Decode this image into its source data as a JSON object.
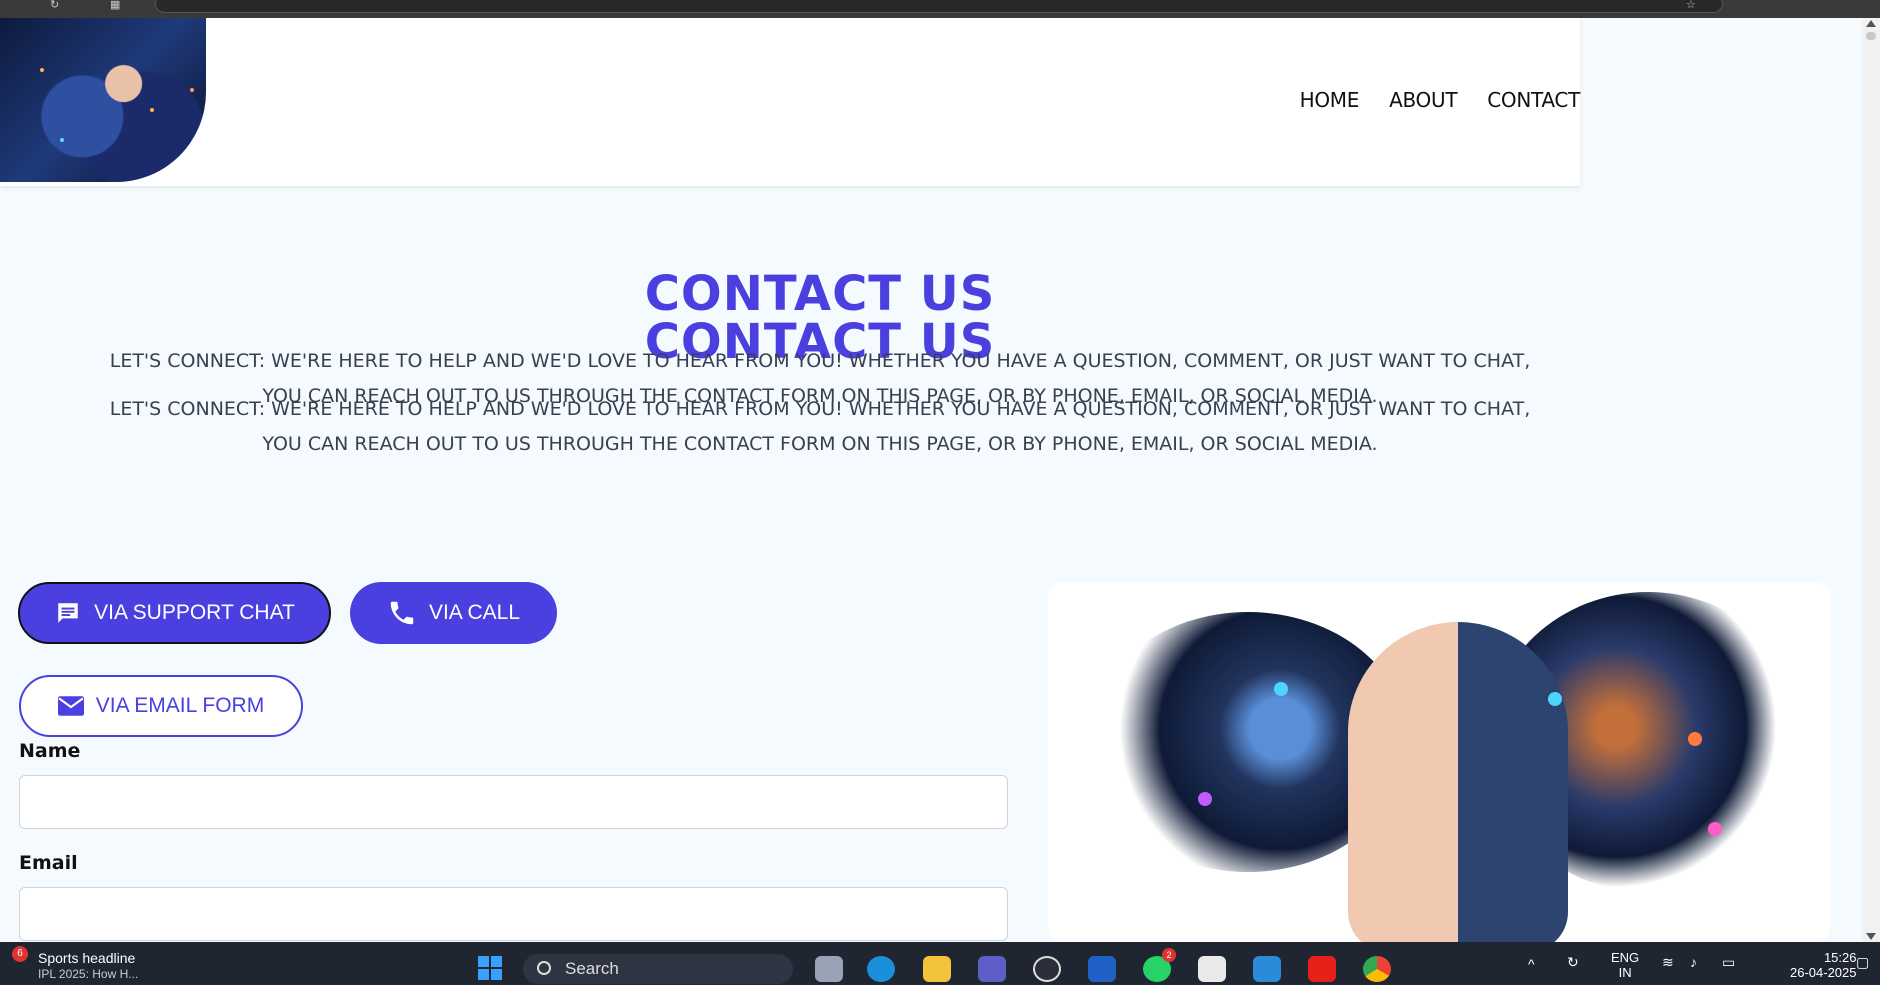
{
  "header": {
    "nav": [
      {
        "label": "HOME"
      },
      {
        "label": "ABOUT"
      },
      {
        "label": "CONTACT"
      }
    ]
  },
  "hero": {
    "title": "CONTACT US",
    "title_duplicate": "CONTACT US",
    "text_line1": "LET'S CONNECT: WE'RE HERE TO HELP AND WE'D LOVE TO HEAR FROM YOU! WHETHER YOU HAVE A QUESTION, COMMENT, OR JUST WANT TO CHAT,",
    "text_line2": "YOU CAN REACH OUT TO US THROUGH THE CONTACT FORM ON THIS PAGE, OR BY PHONE, EMAIL, OR SOCIAL MEDIA.",
    "text_dup_line1": "LET'S CONNECT: WE'RE HERE TO HELP AND WE'D LOVE TO HEAR FROM YOU! WHETHER YOU HAVE A QUESTION, COMMENT, OR JUST WANT TO CHAT,",
    "text_dup_line2": "YOU CAN REACH OUT TO US THROUGH THE CONTACT FORM ON THIS PAGE, OR BY PHONE, EMAIL, OR SOCIAL MEDIA."
  },
  "contact_buttons": {
    "support_chat": "VIA SUPPORT CHAT",
    "call": "VIA CALL",
    "email_form": "VIA EMAIL FORM"
  },
  "form": {
    "name_label": "Name",
    "name_value": "",
    "email_label": "Email",
    "email_value": ""
  },
  "colors": {
    "accent": "#4a40e0",
    "page_bg": "#f4fafd"
  },
  "taskbar": {
    "news_badge": "6",
    "news_title": "Sports headline",
    "news_sub": "IPL 2025: How H...",
    "search_label": "Search",
    "whatsapp_badge": "2",
    "lang": "ENG",
    "lang_sub": "IN",
    "time": "15:26",
    "date": "26-04-2025"
  }
}
